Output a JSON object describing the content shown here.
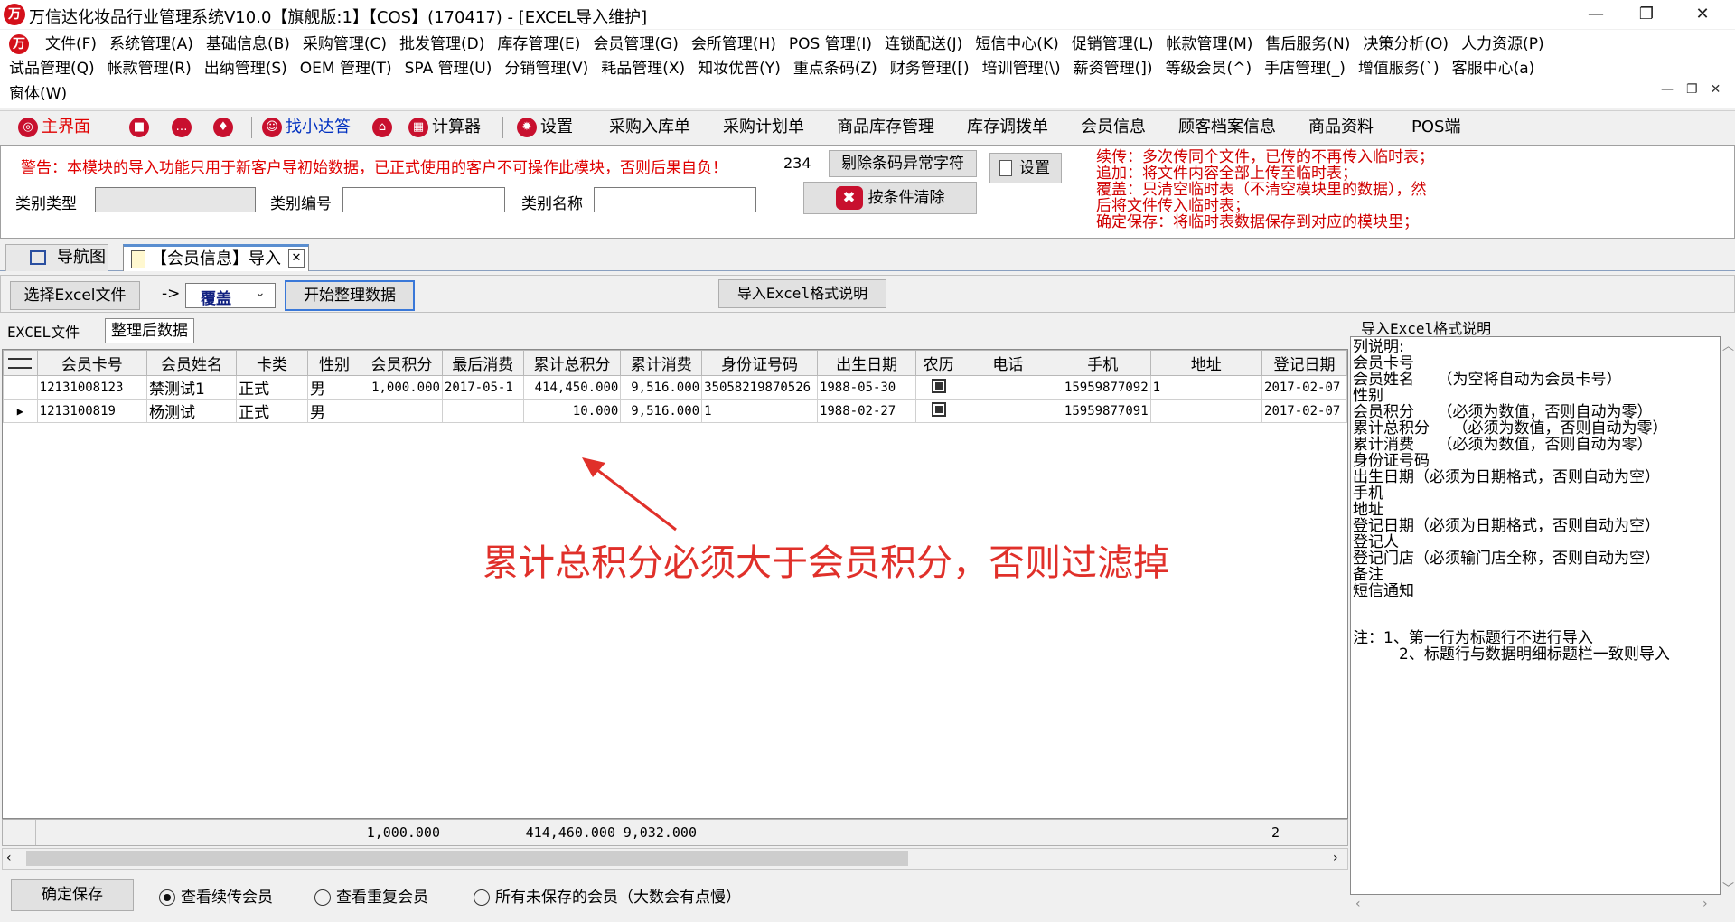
{
  "window": {
    "title": "万信达化妆品行业管理系统V10.0【旗舰版:1】【COS】(170417) - [EXCEL导入维护]",
    "minimize": "—",
    "restore": "❐",
    "close": "✕"
  },
  "menu": {
    "row1": [
      "文件(F)",
      "系统管理(A)",
      "基础信息(B)",
      "采购管理(C)",
      "批发管理(D)",
      "库存管理(E)",
      "会员管理(G)",
      "会所管理(H)",
      "POS 管理(I)",
      "连锁配送(J)",
      "短信中心(K)",
      "促销管理(L)",
      "帐款管理(M)",
      "售后服务(N)",
      "决策分析(O)",
      "人力资源(P)"
    ],
    "row2": [
      "试品管理(Q)",
      "帐款管理(R)",
      "出纳管理(S)",
      "OEM 管理(T)",
      "SPA 管理(U)",
      "分销管理(V)",
      "耗品管理(X)",
      "知妆优普(Y)",
      "重点条码(Z)",
      "财务管理([)",
      "培训管理(\\)",
      "薪资管理(])",
      "等级会员(^)",
      "手店管理(_)",
      "增值服务(`)",
      "客服中心(a)"
    ],
    "row3": [
      "窗体(W)"
    ],
    "mdi_controls": [
      "—",
      "❐",
      "✕"
    ]
  },
  "toolbar": {
    "items": [
      "主界面",
      "找小达答",
      "计算器",
      "设置",
      "采购入库单",
      "采购计划单",
      "商品库存管理",
      "库存调拨单",
      "会员信息",
      "顾客档案信息",
      "商品资料",
      "POS端"
    ]
  },
  "filter": {
    "warning": "警告：本模块的导入功能只用于新客户导初始数据，已正式使用的客户不可操作此模块，否则后果自负！",
    "count": "234",
    "remove_btn": "剔除条码异常字符",
    "settings_btn": "设置",
    "clear_btn": "按条件清除",
    "type_label": "类别类型",
    "code_label": "类别编号",
    "name_label": "类别名称",
    "notes": [
      "续传：多次传同个文件，已传的不再传入临时表；",
      "追加：将文件内容全部上传至临时表；",
      "覆盖：只清空临时表（不清空模块里的数据），然",
      "后将文件传入临时表；",
      "确定保存：将临时表数据保存到对应的模块里；"
    ]
  },
  "tabs": [
    {
      "label": "导航图"
    },
    {
      "label": "【会员信息】导入",
      "close": "✕"
    }
  ],
  "actions": {
    "select_file": "选择Excel文件",
    "arrow": "->",
    "mode": "覆盖",
    "start": "开始整理数据",
    "format_help": "导入Excel格式说明"
  },
  "subtabs": [
    "EXCEL文件",
    "整理后数据"
  ],
  "grid": {
    "columns": [
      "会员卡号",
      "会员姓名",
      "卡类",
      "性别",
      "会员积分",
      "最后消费",
      "累计总积分",
      "累计消费",
      "身份证号码",
      "出生日期",
      "农历",
      "电话",
      "手机",
      "地址",
      "登记日期"
    ],
    "rows": [
      {
        "marker": "",
        "card": "12131008123",
        "name": "禁测试1",
        "type": "正式",
        "gender": "男",
        "points": "1,000.000",
        "last": "2017-05-1",
        "total_points": "414,450.000",
        "total_spend": "9,516.000",
        "id": "35058219870526",
        "birth": "1988-05-30",
        "lunar": true,
        "phone": "",
        "mobile": "15959877092",
        "addr": "1",
        "reg": "2017-02-07"
      },
      {
        "marker": "▶",
        "card": "1213100819",
        "name": "杨测试",
        "type": "正式",
        "gender": "男",
        "points": "",
        "last": "",
        "total_points": "10.000",
        "total_spend": "9,516.000",
        "id": "1",
        "birth": "1988-02-27",
        "lunar": true,
        "phone": "",
        "mobile": "15959877091",
        "addr": "",
        "reg": "2017-02-07"
      }
    ],
    "summary": {
      "points": "1,000.000",
      "total_points": "414,460.000",
      "total_spend": "9,032.000",
      "reg": "2"
    }
  },
  "annotation": "累计总积分必须大于会员积分，否则过滤掉",
  "help_panel": {
    "title": "导入Excel格式说明",
    "lines": [
      "列说明:",
      "会员卡号",
      "会员姓名　　（为空将自动为会员卡号）",
      "性别",
      "会员积分　　（必须为数值，否则自动为零）",
      "累计总积分　　（必须为数值，否则自动为零）",
      "累计消费　　（必须为数值，否则自动为零）",
      "身份证号码",
      "出生日期（必须为日期格式，否则自动为空）",
      "手机",
      "地址",
      "登记日期（必须为日期格式，否则自动为空）",
      "登记人",
      "登记门店（必须输门店全称，否则自动为空）",
      "备注",
      "短信通知",
      "",
      "注：1、第一行为标题行不进行导入",
      "　　　2、标题行与数据明细标题栏一致则导入"
    ]
  },
  "bottom": {
    "save": "确定保存",
    "radio1": "查看续传会员",
    "radio2": "查看重复会员",
    "radio3": "所有未保存的会员（大数会有点慢）"
  }
}
